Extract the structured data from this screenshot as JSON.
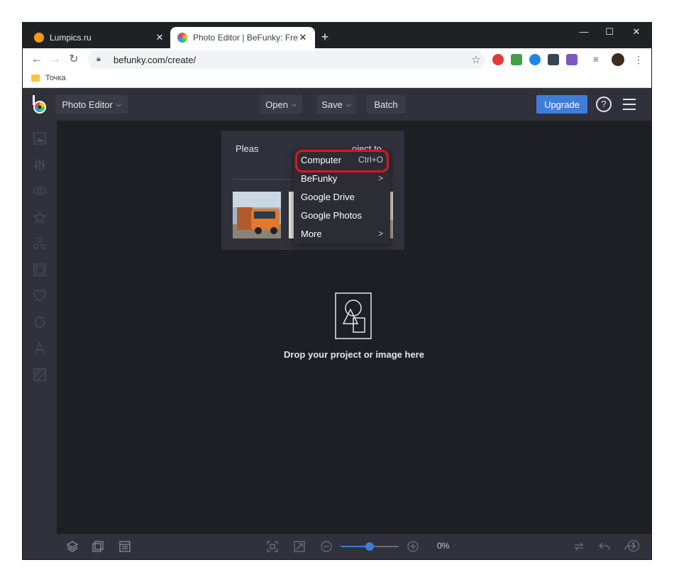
{
  "browser": {
    "tabs": [
      {
        "title": "Lumpics.ru",
        "active": false
      },
      {
        "title": "Photo Editor | BeFunky: Free Onl",
        "active": true
      }
    ],
    "new_tab_icon": "plus-icon",
    "address": "befunky.com/create/",
    "bookmark": "Точка"
  },
  "app": {
    "editor_menu": "Photo Editor",
    "open_label": "Open",
    "save_label": "Save",
    "batch_label": "Batch",
    "upgrade_label": "Upgrade",
    "help_label": "?",
    "accent_color": "#3f7ddb",
    "highlight_color": "#e0141b"
  },
  "panel": {
    "text_left": "Pleas",
    "text_right": "oject to"
  },
  "open_menu": {
    "items": [
      {
        "label": "Computer",
        "shortcut": "Ctrl+O"
      },
      {
        "label": "BeFunky",
        "submenu": ">"
      },
      {
        "label": "Google Drive"
      },
      {
        "label": "Google Photos"
      },
      {
        "label": "More",
        "submenu": ">"
      }
    ]
  },
  "canvas": {
    "drop_text": "Drop your project or image here"
  },
  "bottombar": {
    "zoom_value": "0%",
    "zoom_fraction": 0.5
  }
}
